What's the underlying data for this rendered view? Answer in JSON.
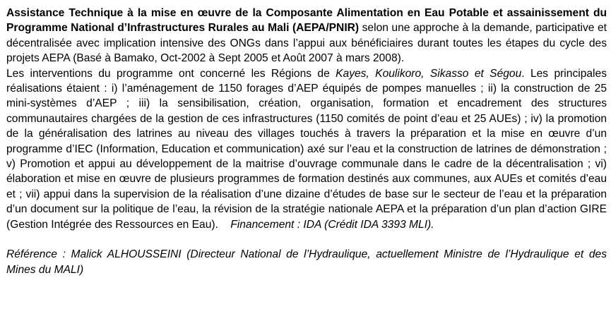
{
  "project": {
    "title_bold": "Assistance Technique à la mise en œuvre de la Composante Alimentation en Eau Potable et assainissement du Programme National d’Infrastructures Rurales au Mali (AEPA/PNIR)",
    "intro": " selon une approche à la demande, participative et décentralisée avec implication intensive des ONGs dans l’appui aux bénéficiaires durant toutes les étapes du cycle des projets AEPA (Basé à Bamako, Oct-2002 à Sept 2005 et Août 2007 à mars 2008).",
    "regions_prefix": "Les interventions du programme ont concerné les Régions de ",
    "regions_italic": "Kayes, Koulikoro, Sikasso et Ségou",
    "realisations": ". Les principales réalisations étaient : i) l’aménagement de 1150 forages d’AEP équipés de pompes manuelles ; ii) la construction de 25 mini-systèmes d’AEP ; iii) la sensibilisation, création, organisation, formation et encadrement des structures communautaires chargées de la gestion de ces infrastructures (1150 comités de point d’eau et 25 AUEs) ; iv) la promotion de la généralisation des latrines au niveau des villages touchés à travers la préparation et la mise en œuvre d’un programme d’IEC (Information, Education et communication) axé sur l’eau et la construction de latrines de démonstration ; v) Promotion et appui au développement de la maitrise d’ouvrage communale dans le cadre de la décentralisation ; vi) élaboration et mise en œuvre de plusieurs programmes de formation destinés aux communes, aux AUEs et comités d’eau et ; vii) appui dans la supervision de la réalisation d’une dizaine d’études de base sur le secteur de l’eau et la préparation d’un document sur la politique de l’eau, la révision de la stratégie nationale AEPA et la préparation d’un plan d’action GIRE (Gestion Intégrée des Ressources en Eau).",
    "financement": "Financement : IDA (Crédit IDA 3393 MLI)."
  },
  "reference": {
    "text": "Référence : Malick ALHOUSSEINI (Directeur National de l’Hydraulique, actuellement Ministre de l’Hydraulique et des Mines du MALI)"
  }
}
